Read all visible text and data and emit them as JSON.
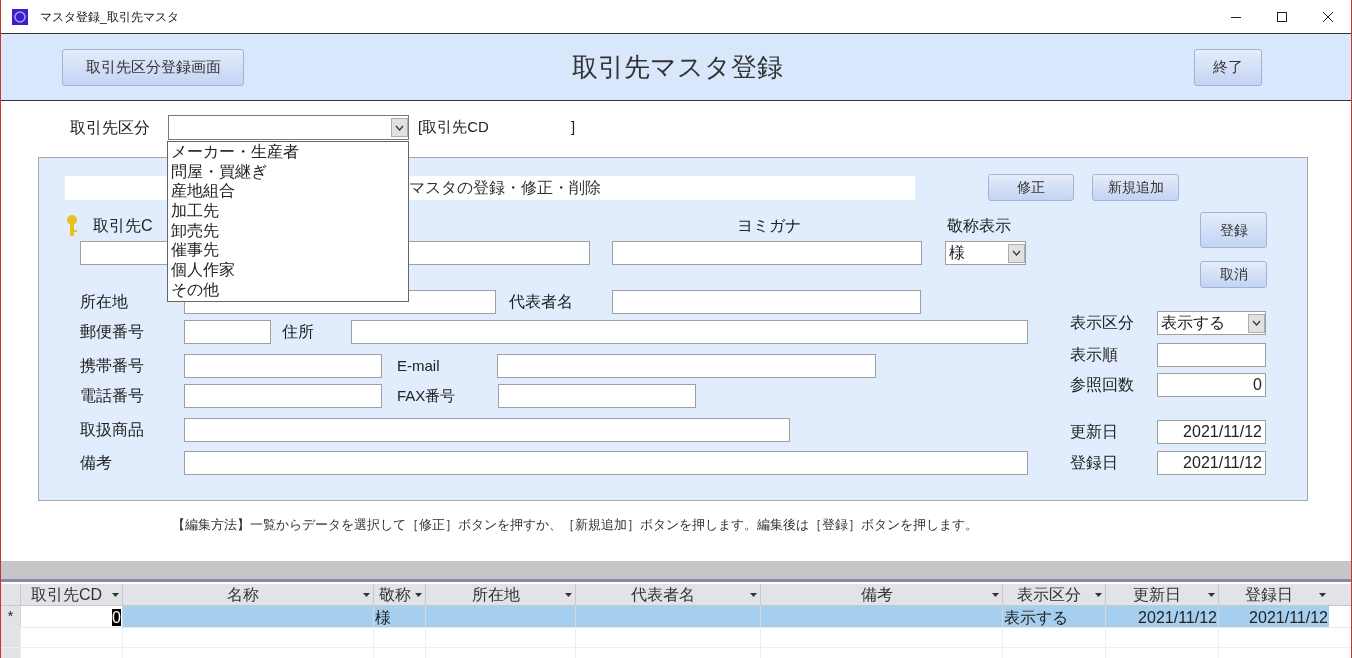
{
  "window": {
    "title": "マスタ登録_取引先マスタ"
  },
  "header": {
    "left_button": "取引先区分登録画面",
    "title": "取引先マスタ登録",
    "right_button": "終了"
  },
  "partner_type": {
    "label": "取引先区分",
    "expanded": true,
    "code_label": "[取引先CD",
    "code_close": "]",
    "options": [
      "メーカー・生産者",
      "問屋・買継ぎ",
      "産地組合",
      "加工先",
      "卸売先",
      "催事先",
      "個人作家",
      "その他"
    ]
  },
  "form": {
    "heading": "マスタの登録・修正・削除",
    "top_buttons": [
      "修正",
      "新規追加"
    ],
    "side_buttons": [
      "登録",
      "取消"
    ],
    "code_label": "取引先C",
    "kana_label": "ヨミガナ",
    "honorific": {
      "label": "敬称表示",
      "value": "様"
    },
    "rows": [
      {
        "label": "所在地",
        "second_label": "代表者名"
      },
      {
        "label": "郵便番号",
        "second_label": "住所"
      },
      {
        "label": "携帯番号",
        "second_label": "E-mail"
      },
      {
        "label": "電話番号",
        "second_label": "FAX番号"
      },
      {
        "label": "取扱商品"
      },
      {
        "label": "備考"
      }
    ],
    "side": [
      {
        "kind": "select",
        "label": "表示区分",
        "value": "表示する"
      },
      {
        "kind": "input",
        "label": "表示順"
      },
      {
        "kind": "input",
        "label": "参照回数",
        "value": "0"
      },
      {
        "kind": "input",
        "label": "更新日",
        "value": "2021/11/12"
      },
      {
        "kind": "input",
        "label": "登録日",
        "value": "2021/11/12"
      }
    ]
  },
  "instruction": "【編集方法】一覧からデータを選択して［修正］ボタンを押すか、［新規追加］ボタンを押します。編集後は［登録］ボタンを押します。",
  "table": {
    "columns": [
      "取引先CD",
      "名称",
      "敬称",
      "所在地",
      "代表者名",
      "備考",
      "表示区分",
      "更新日",
      "登録日"
    ],
    "rows": [
      {
        "marker": "*",
        "selected": true,
        "cells": [
          "0",
          "",
          "様",
          "",
          "",
          "",
          "表示する",
          "2021/11/12",
          "2021/11/12"
        ]
      }
    ]
  }
}
